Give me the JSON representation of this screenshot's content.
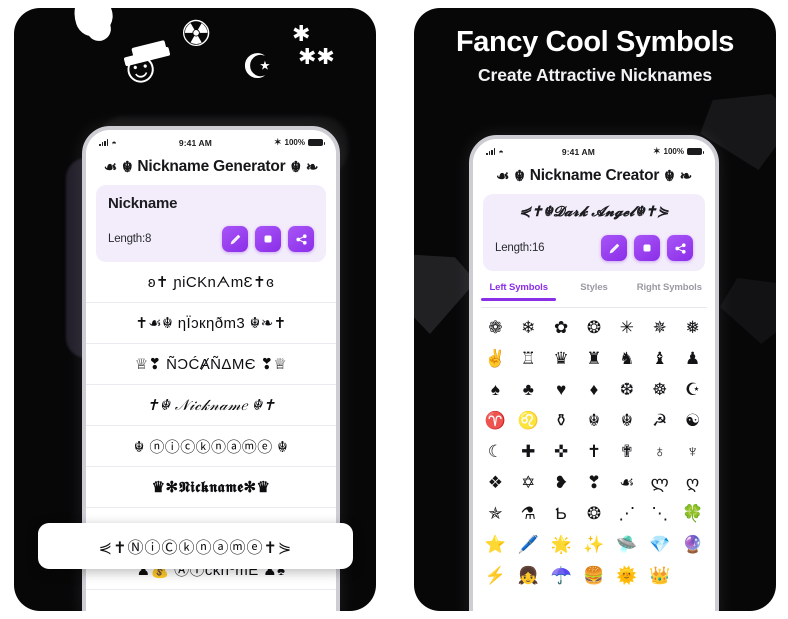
{
  "left_card": {
    "decorations": [
      "white-blob",
      "top-hat-face",
      "radiation-symbol",
      "star-and-crescent",
      "asterisk-cluster"
    ],
    "phone": {
      "status_bar": {
        "signal": "signal-bars",
        "wifi": "wifi-icon",
        "time": "9:41 AM",
        "bluetooth": "bluetooth-icon",
        "battery_pct": "100%",
        "battery": "battery-icon"
      },
      "app_title": {
        "left_ornament_1": "☙",
        "left_ornament_2": "☬",
        "text": "Nickname Generator",
        "right_ornament_1": "☬",
        "right_ornament_2": "❧"
      },
      "preview": {
        "name": "Nickname",
        "length_label": "Length:8",
        "actions": [
          {
            "name": "edit-button",
            "icon": "pencil-icon"
          },
          {
            "name": "copy-button",
            "icon": "copy-icon"
          },
          {
            "name": "share-button",
            "icon": "share-icon"
          }
        ]
      },
      "nicknames": [
        "ʚ✝ ɲiCKnᗅmƐ✝ɞ",
        "✝☙☬ ƞÏɔкƞðm3 ☬❧✝",
        "♕❣ ÑƆĆȺÑΔΜЄ ❣♕",
        "✝☬ 𝒩𝒾𝒸𝓀𝓃𝒶𝓂𝑒 ☬✝",
        "☬ ⓝⓘⓒⓚⓝⓐⓜⓔ ☬",
        "♛✻𝕹𝖎𝖈𝖐𝖓𝖆𝖒𝖊✻♛",
        "♟💰 ⒶⒾƈƙnºmE ♟♠"
      ],
      "highlighted_nickname": "⋞✝ⓃⓘⒸⓚⓝⓐⓜⓔ✝⋟"
    }
  },
  "right_card": {
    "headline": "Fancy Cool Symbols",
    "subheadline": "Create Attractive Nicknames",
    "decorations": [
      "dark-gem-left",
      "dark-gem-right-top",
      "dark-gem-right-bottom"
    ],
    "phone": {
      "status_bar": {
        "signal": "signal-bars",
        "wifi": "wifi-icon",
        "time": "9:41 AM",
        "bluetooth": "bluetooth-icon",
        "battery_pct": "100%",
        "battery": "battery-icon"
      },
      "app_title": {
        "left_ornament_1": "☙",
        "left_ornament_2": "☬",
        "text": "Nickname Creator",
        "right_ornament_1": "☬",
        "right_ornament_2": "❧"
      },
      "preview": {
        "name": "⋞✝☬𝓓𝓪𝓻𝓴 𝓐𝓷𝓰𝓮𝓵☬✝⋟",
        "length_label": "Length:16",
        "actions": [
          {
            "name": "edit-button",
            "icon": "pencil-icon"
          },
          {
            "name": "copy-button",
            "icon": "copy-icon"
          },
          {
            "name": "share-button",
            "icon": "share-icon"
          }
        ]
      },
      "tabs": [
        {
          "label": "Left Symbols",
          "active": true
        },
        {
          "label": "Styles",
          "active": false
        },
        {
          "label": "Right Symbols",
          "active": false
        }
      ],
      "symbols": [
        "❁",
        "❄",
        "✿",
        "❂",
        "✳",
        "✵",
        "❅",
        "✌️",
        "♖",
        "♛",
        "♜",
        "♞",
        "♝",
        "♟",
        "♠",
        "♣",
        "♥",
        "♦",
        "❆",
        "☸",
        "☪",
        "♈",
        "♌",
        "⚱",
        "☬",
        "☬",
        "☭",
        "☯",
        "☾",
        "✚",
        "✜",
        "✝",
        "✟",
        "♁",
        "♆",
        "❖",
        "✡",
        "❥",
        "❣",
        "☙",
        "ლ",
        "ღ",
        "✯",
        "⚗",
        "Ƅ",
        "❂",
        "⋰",
        "⋱",
        "🍀",
        "⭐",
        "🖊️",
        "🌟",
        "✨",
        "🛸",
        "💎",
        "🔮",
        "⚡",
        "👧",
        "☂️",
        "🍔",
        "🌞",
        "👑"
      ]
    }
  },
  "colors": {
    "card_bg": "#070708",
    "accent_purple": "#8b2ee8",
    "preview_bg": "#f3edfb",
    "phone_frame": "#cfcdd4",
    "page_bg": "#ffffff"
  }
}
